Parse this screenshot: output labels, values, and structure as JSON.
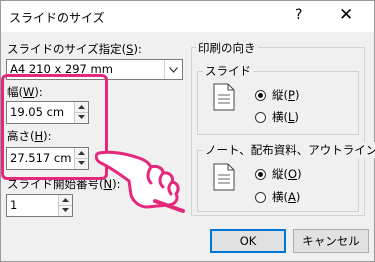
{
  "dialog": {
    "title": "スライドのサイズ",
    "help": "?",
    "close": "✕"
  },
  "slide_size": {
    "label_text": "スライドのサイズ指定(",
    "label_key": "S",
    "label_end": "):",
    "value": "A4 210 x 297 mm"
  },
  "width": {
    "label_text": "幅(",
    "label_key": "W",
    "label_end": "):",
    "value": "19.05 cm"
  },
  "height": {
    "label_text": "高さ(",
    "label_key": "H",
    "label_end": "):",
    "value": "27.517 cm"
  },
  "start_number": {
    "label_text": "スライド開始番号(",
    "label_key": "N",
    "label_end": "):",
    "value": "1"
  },
  "orientation": {
    "title": "印刷の向き",
    "slides": {
      "title": "スライド",
      "portrait_text": "縦(",
      "portrait_key": "P",
      "landscape_text": "横(",
      "landscape_key": "L",
      "close": ")"
    },
    "notes": {
      "title": "ノート、配布資料、アウトライン",
      "portrait_text": "縦(",
      "portrait_key": "O",
      "landscape_text": "横(",
      "landscape_key": "A",
      "close": ")"
    }
  },
  "buttons": {
    "ok": "OK",
    "cancel": "キャンセル"
  },
  "icons": [
    "page-icon",
    "radio-icon",
    "pointing-hand-icon",
    "dropdown-arrow-icon",
    "spinner-up-icon",
    "spinner-down-icon"
  ],
  "colors": {
    "highlight": "#e6287d",
    "default_button_border": "#0078d7"
  }
}
